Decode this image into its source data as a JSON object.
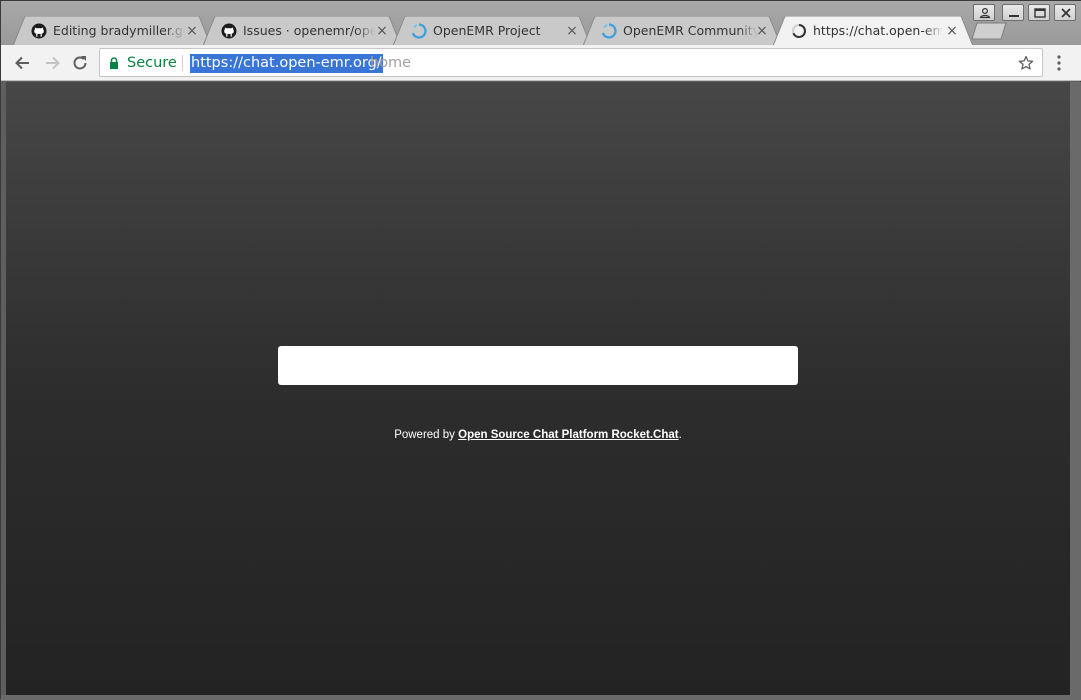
{
  "tabs": [
    {
      "title": "Editing bradymiller.github.io",
      "icon": "github-icon",
      "active": false
    },
    {
      "title": "Issues · openemr/openemr",
      "icon": "github-icon",
      "active": false
    },
    {
      "title": "OpenEMR Project",
      "icon": "openemr-icon",
      "active": false
    },
    {
      "title": "OpenEMR Community",
      "icon": "openemr-icon",
      "active": false
    },
    {
      "title": "https://chat.open-emr.org/home",
      "icon": "loading-spinner-icon",
      "active": true
    }
  ],
  "tab_close_glyph": "×",
  "toolbar": {
    "security_label": "Secure",
    "url_selected": "https://chat.open-emr.org/",
    "url_rest": "home"
  },
  "content": {
    "powered_prefix": "Powered by ",
    "powered_link": "Open Source Chat Platform Rocket.Chat",
    "powered_suffix": "."
  },
  "colors": {
    "secure_green": "#0b8043",
    "selection_blue": "#3875d6",
    "openemr_blue": "#3aa0e0"
  }
}
